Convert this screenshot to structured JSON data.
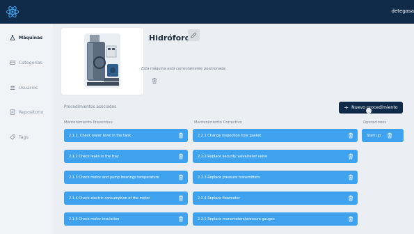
{
  "topbar": {
    "logo_icon": "atom-icon",
    "user": "detegasa"
  },
  "sidebar": {
    "items": [
      {
        "label": "Máquinas",
        "icon": "flask-icon",
        "active": true
      },
      {
        "label": "Categorías",
        "icon": "card-icon",
        "active": false
      },
      {
        "label": "Usuarios",
        "icon": "users-icon",
        "active": false
      },
      {
        "label": "Repositorio",
        "icon": "file-icon",
        "active": false
      },
      {
        "label": "Tags",
        "icon": "tag-icon",
        "active": false
      }
    ]
  },
  "machine": {
    "title": "Hidróforo",
    "status": "Esta máquina está correctamente posicionada",
    "edit_icon": "pencil-icon",
    "delete_icon": "trash-icon"
  },
  "procedures": {
    "section_label": "Procedimientos asociados",
    "new_button": "Nuevo procedimiento",
    "columns": {
      "preventive": "Mantenimiento Preventivo",
      "corrective": "Mantenimiento Correctivo",
      "operations": "Operaciones"
    },
    "preventive": [
      "2.1.1. Check water level in the tank",
      "2.1.2 Check leaks in the tray",
      "2.1.3 Check motor and pump bearings temperature",
      "2.1.4 Check electric consumption of the motor",
      "2.1.5 Check motor insulation"
    ],
    "corrective": [
      "2.2.1 Change inspection hole gasket",
      "2.2.2 Replace security valve/relief valve",
      "2.2.3 Replace pressure transmitters",
      "2.2.4 Replace flowmeter",
      "2.2.5 Replace manometers/pressure gauges"
    ],
    "operations": [
      "Start up"
    ]
  },
  "colors": {
    "topbar": "#102a4a",
    "procedure_button": "#3fa2ee",
    "background": "#ebeef3"
  }
}
